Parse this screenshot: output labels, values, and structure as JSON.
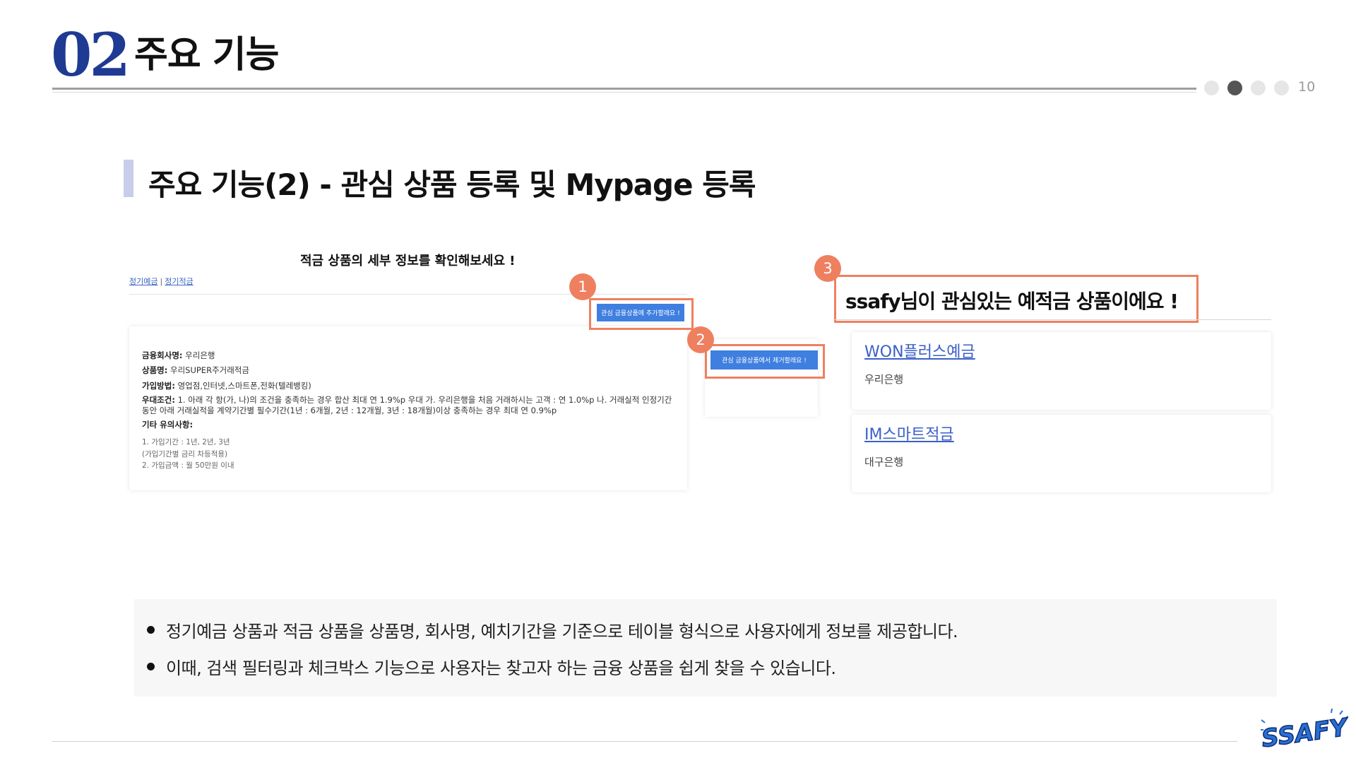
{
  "header": {
    "section_number": "02",
    "title": "주요 기능",
    "page_number": "10",
    "dots": 4,
    "active_dot": 1
  },
  "section": {
    "title": "주요 기능(2) - 관심 상품 등록 및 Mypage 등록"
  },
  "left_panel": {
    "heading": "적금 상품의 세부 정보를 확인해보세요 !",
    "links": [
      "정기예금",
      "정기적금"
    ],
    "link_separator": "|",
    "add_button": "관심 금융상품에 추가할래요 !",
    "remove_button": "관심 금융상품에서 제거할래요 !",
    "badges": [
      "1",
      "2",
      "3"
    ],
    "details": {
      "company_label": "금융회사명:",
      "company_value": "우리은행",
      "product_label": "상품명:",
      "product_value": "우리SUPER주거래적금",
      "method_label": "가입방법:",
      "method_value": "영업점,인터넷,스마트폰,전화(텔레뱅킹)",
      "pref_label": "우대조건:",
      "pref_value": "1. 아래 각 항(가, 나)의 조건을 충족하는 경우 합산 최대 연 1.9%p 우대 가. 우리은행을 처음 거래하시는 고객 : 연 1.0%p 나. 거래실적 인정기간 동안 아래 거래실적을 계약기간별 필수기간(1년 : 6개월, 2년 : 12개월, 3년 : 18개월)이상 충족하는 경우 최대 연 0.9%p",
      "etc_label": "기타 유의사항:",
      "etc_lines": [
        "1. 가입기간 : 1년, 2년, 3년",
        "(가입기간별 금리 차등적용)",
        "2. 가입금액 : 월 50만원 이내"
      ]
    }
  },
  "right_panel": {
    "title": "ssafy님이 관심있는 예적금 상품이에요 !",
    "products": [
      {
        "name": "WON플러스예금",
        "bank": "우리은행"
      },
      {
        "name": "IM스마트적금",
        "bank": "대구은행"
      }
    ]
  },
  "info": {
    "bullets": [
      "정기예금 상품과 적금 상품을 상품명, 회사명, 예치기간을 기준으로 테이블 형식으로 사용자에게 정보를 제공합니다.",
      "이때, 검색 필터링과 체크박스 기능으로 사용자는 찾고자 하는 금융 상품을 쉽게 찾을 수 있습니다."
    ]
  },
  "logo": {
    "text": "SSAFY",
    "color": "#2a6fd6"
  },
  "colors": {
    "accent_number": "#1f3a93",
    "highlight": "#ee8060",
    "button": "#3f7fe0",
    "link": "#3b5fc8",
    "section_bar": "#c8cdeb"
  }
}
